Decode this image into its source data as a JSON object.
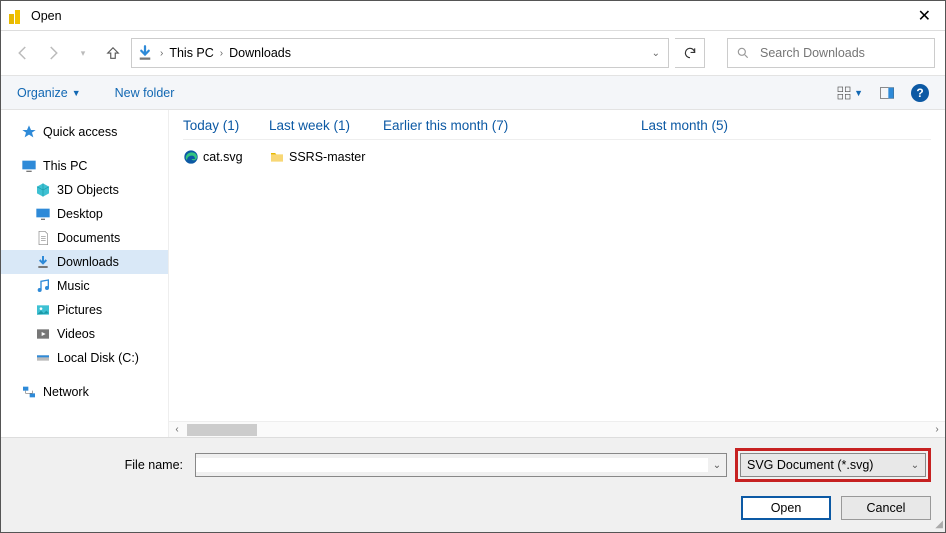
{
  "title": "Open",
  "breadcrumb": {
    "seg1": "This PC",
    "seg2": "Downloads"
  },
  "search": {
    "placeholder": "Search Downloads"
  },
  "toolbar": {
    "organize": "Organize",
    "new_folder": "New folder"
  },
  "sidebar": {
    "quick": "Quick access",
    "thispc": "This PC",
    "items": {
      "objects3d": "3D Objects",
      "desktop": "Desktop",
      "documents": "Documents",
      "downloads": "Downloads",
      "music": "Music",
      "pictures": "Pictures",
      "videos": "Videos",
      "localdisk": "Local Disk (C:)"
    },
    "network": "Network"
  },
  "groups": [
    {
      "header": "Today (1)",
      "files": [
        {
          "name": "cat.svg",
          "icon": "edge"
        }
      ]
    },
    {
      "header": "Last week (1)",
      "files": [
        {
          "name": "SSRS-master",
          "icon": "folder"
        }
      ]
    },
    {
      "header": "Earlier this month (7)",
      "files": []
    },
    {
      "header": "Last month (5)",
      "files": []
    }
  ],
  "footer": {
    "filename_label": "File name:",
    "filename_value": "",
    "filter": "SVG Document (*.svg)",
    "open": "Open",
    "cancel": "Cancel"
  }
}
